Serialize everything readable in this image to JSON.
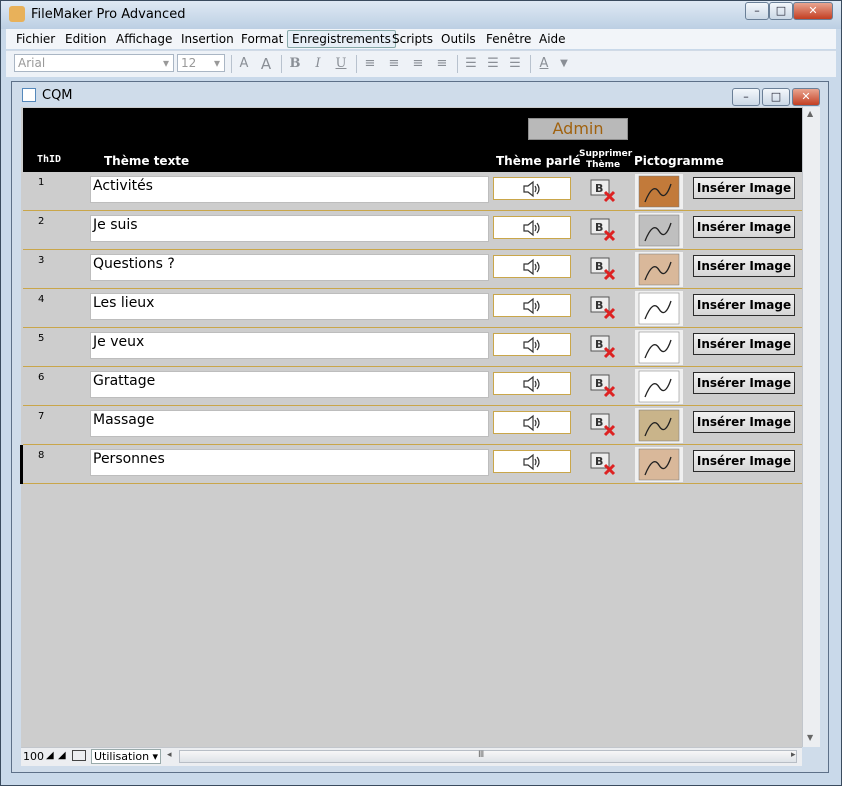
{
  "app": {
    "title": "FileMaker Pro Advanced",
    "colors": {
      "accent": "#a0620f",
      "row_border": "#c9a64a",
      "header_bg": "#000000"
    }
  },
  "window_controls": {
    "minimize": "–",
    "maximize": "□",
    "close": "✕"
  },
  "menu": [
    "Fichier",
    "Edition",
    "Affichage",
    "Insertion",
    "Format",
    "Enregistrements",
    "Scripts",
    "Outils",
    "Fenêtre",
    "Aide"
  ],
  "toolbar": {
    "font": "Arial",
    "size": "12"
  },
  "document": {
    "title": "CQM"
  },
  "layout": {
    "admin_button": "Admin",
    "headers": {
      "id": "ThID",
      "theme_text": "Thème texte",
      "theme_spoken": "Thème parlé",
      "delete_theme_line1": "Supprimer",
      "delete_theme_line2": "Thème",
      "pictogram": "Pictogramme"
    },
    "insert_image_label": "Insérer Image",
    "rows": [
      {
        "id": "1",
        "text": "Activités"
      },
      {
        "id": "2",
        "text": "Je suis"
      },
      {
        "id": "3",
        "text": "Questions ?"
      },
      {
        "id": "4",
        "text": "Les lieux"
      },
      {
        "id": "5",
        "text": "Je veux"
      },
      {
        "id": "6",
        "text": "Grattage"
      },
      {
        "id": "7",
        "text": "Massage"
      },
      {
        "id": "8",
        "text": "Personnes"
      }
    ]
  },
  "statusbar": {
    "zoom": "100",
    "mode": "Utilisation"
  }
}
